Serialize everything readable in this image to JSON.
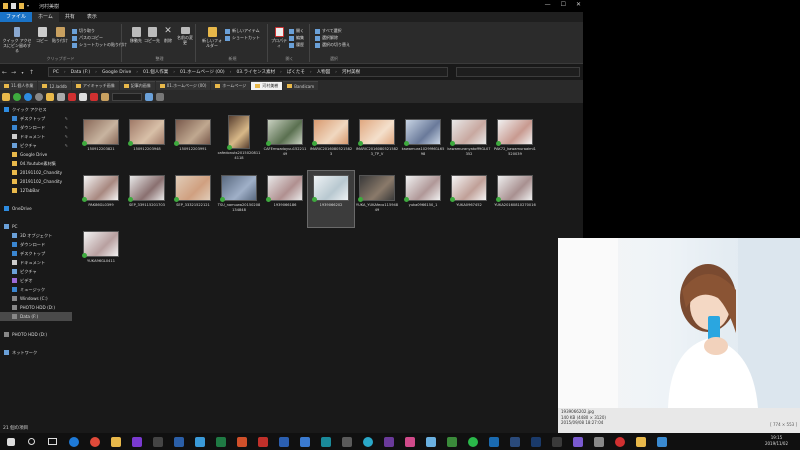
{
  "window": {
    "title": "河村美樹"
  },
  "ribbon": {
    "tabs": [
      "ファイル",
      "ホーム",
      "共有",
      "表示"
    ],
    "groups": [
      {
        "name": "クリップボード",
        "buttons": [
          "クイック アクセスにピン留めする",
          "コピー",
          "貼り付け"
        ],
        "small": [
          "切り取り",
          "パスのコピー",
          "ショートカットの貼り付け"
        ]
      },
      {
        "name": "整理",
        "buttons": [
          "移動先",
          "コピー先",
          "削除",
          "名前の変更"
        ]
      },
      {
        "name": "新規",
        "buttons": [
          "新しいフォルダー"
        ],
        "small": [
          "新しいアイテム",
          "ショートカット"
        ]
      },
      {
        "name": "開く",
        "buttons": [
          "プロパティ"
        ],
        "small": [
          "開く",
          "編集",
          "履歴"
        ]
      },
      {
        "name": "選択",
        "small": [
          "すべて選択",
          "選択解除",
          "選択の切り替え"
        ]
      }
    ]
  },
  "address": {
    "path": [
      "PC",
      "Data (F:)",
      "Google Drive",
      "01.個人作業",
      "01.ホームページ (00)",
      "03.ライセンス素材",
      "ぱくたそ",
      "人物図",
      "河村美樹"
    ]
  },
  "qtabs": [
    "11.個人作業",
    "12.laddb",
    "アイキャッチ画像",
    "記事内画像",
    "01.ホームページ (00)",
    "ホームページ",
    "河村美樹",
    "Bandicam"
  ],
  "qtab_active": 6,
  "nav": [
    {
      "label": "クイック アクセス",
      "color": "#2d8be0",
      "indent": 0
    },
    {
      "label": "デスクトップ",
      "color": "#3a86d0",
      "indent": 1,
      "pin": true
    },
    {
      "label": "ダウンロード",
      "color": "#3a86d0",
      "indent": 1,
      "pin": true
    },
    {
      "label": "ドキュメント",
      "color": "#cccccc",
      "indent": 1,
      "pin": true
    },
    {
      "label": "ピクチャ",
      "color": "#6aa0d8",
      "indent": 1,
      "pin": true
    },
    {
      "label": "Google Drive",
      "color": "#e8b84a",
      "indent": 1
    },
    {
      "label": "04.Youtube素材集",
      "color": "#e8b84a",
      "indent": 1
    },
    {
      "label": "20191102_Chandity",
      "color": "#e8b84a",
      "indent": 1
    },
    {
      "label": "20191102_Chandity",
      "color": "#e8b84a",
      "indent": 1
    },
    {
      "label": "12TabBar",
      "color": "#e8b84a",
      "indent": 1
    },
    {
      "label": "",
      "color": "",
      "indent": 0
    },
    {
      "label": "OneDrive",
      "color": "#2d8be0",
      "indent": 0
    },
    {
      "label": "",
      "color": "",
      "indent": 0
    },
    {
      "label": "PC",
      "color": "#6aa0d8",
      "indent": 0
    },
    {
      "label": "3D オブジェクト",
      "color": "#6aa0d8",
      "indent": 1
    },
    {
      "label": "ダウンロード",
      "color": "#3a86d0",
      "indent": 1
    },
    {
      "label": "デスクトップ",
      "color": "#3a86d0",
      "indent": 1
    },
    {
      "label": "ドキュメント",
      "color": "#cccccc",
      "indent": 1
    },
    {
      "label": "ピクチャ",
      "color": "#6aa0d8",
      "indent": 1
    },
    {
      "label": "ビデオ",
      "color": "#9b6ad8",
      "indent": 1
    },
    {
      "label": "ミュージック",
      "color": "#3a86d0",
      "indent": 1
    },
    {
      "label": "Windows (C:)",
      "color": "#888888",
      "indent": 1
    },
    {
      "label": "PHOTO HDD (D:)",
      "color": "#888888",
      "indent": 1
    },
    {
      "label": "Data (F:)",
      "color": "#888888",
      "indent": 1,
      "selected": true
    },
    {
      "label": "",
      "color": "",
      "indent": 0
    },
    {
      "label": "PHOTO HDD (D:)",
      "color": "#888888",
      "indent": 0
    },
    {
      "label": "",
      "color": "",
      "indent": 0
    },
    {
      "label": "ネットワーク",
      "color": "#6aa0d8",
      "indent": 0
    }
  ],
  "files": [
    {
      "name": "150912203821",
      "c1": "#8a6a5a",
      "c2": "#c8b4a0"
    },
    {
      "name": "150912203948",
      "c1": "#a07a68",
      "c2": "#d8c0a8"
    },
    {
      "name": "150912203991",
      "c1": "#7a5a4c",
      "c2": "#c0a890"
    },
    {
      "name": "cafedonuts20150208114118",
      "c1": "#5a4030",
      "c2": "#d8b888",
      "tall": true
    },
    {
      "name": "CAFEmwadoyuu15221149",
      "c1": "#c8d0c0",
      "c2": "#5a7050"
    },
    {
      "name": "IMARIC20160805215823",
      "c1": "#d89a70",
      "c2": "#f0d8c0"
    },
    {
      "name": "IMARIC20160805215823_TP_V",
      "c1": "#e0a880",
      "c2": "#f4e0cc"
    },
    {
      "name": "kawamura10299MGL6598",
      "c1": "#c8d4e4",
      "c2": "#6a7a9a"
    },
    {
      "name": "kawamuranyatoff9GL07352",
      "c1": "#e8e8e8",
      "c2": "#c8a8a0"
    },
    {
      "name": "PAK72_kawamuraaimi1520039",
      "c1": "#f0f0f0",
      "c2": "#c89a90"
    },
    {
      "name": "PAK86GL0399",
      "c1": "#f4f4f4",
      "c2": "#a88880"
    },
    {
      "name": "SEP_339115201703",
      "c1": "#e8e8e8",
      "c2": "#8a7070"
    },
    {
      "name": "SEP_33321522121",
      "c1": "#e0ccb8",
      "c2": "#d0a080"
    },
    {
      "name": "TSU_namuwa20150208134848",
      "c1": "#5a6a80",
      "c2": "#a0b0c8"
    },
    {
      "name": "1939066186",
      "c1": "#e8e8e8",
      "c2": "#b09090"
    },
    {
      "name": "1939066202",
      "c1": "#eef2f4",
      "c2": "#b8c8d0",
      "selected": true
    },
    {
      "name": "YUKA_YUKAfeco11594849",
      "c1": "#3a3a3a",
      "c2": "#8a7a6a"
    },
    {
      "name": "yuka0966150_1",
      "c1": "#f0f0f0",
      "c2": "#b09898"
    },
    {
      "name": "YUKA0967452",
      "c1": "#f4f4f4",
      "c2": "#c0a098"
    },
    {
      "name": "YUKA20160810270016",
      "c1": "#eeeeee",
      "c2": "#a89090"
    },
    {
      "name": "YUKA96GL0411",
      "c1": "#f2f2f2",
      "c2": "#b8a0a0"
    }
  ],
  "status": {
    "count": "21 個の項目"
  },
  "preview": {
    "filename": "1939066202.jpg",
    "size": "140 KB",
    "resolution": "(4480 × 3120)",
    "date": "2015/09/08 18:27:04",
    "dims": "[ 774 × 553 ]"
  },
  "clock": {
    "time": "19:15",
    "date": "2019/11/02"
  },
  "colors": {
    "accent": "#1a73c7",
    "selection": "#4a4a4a",
    "folder": "#e8b84a"
  }
}
